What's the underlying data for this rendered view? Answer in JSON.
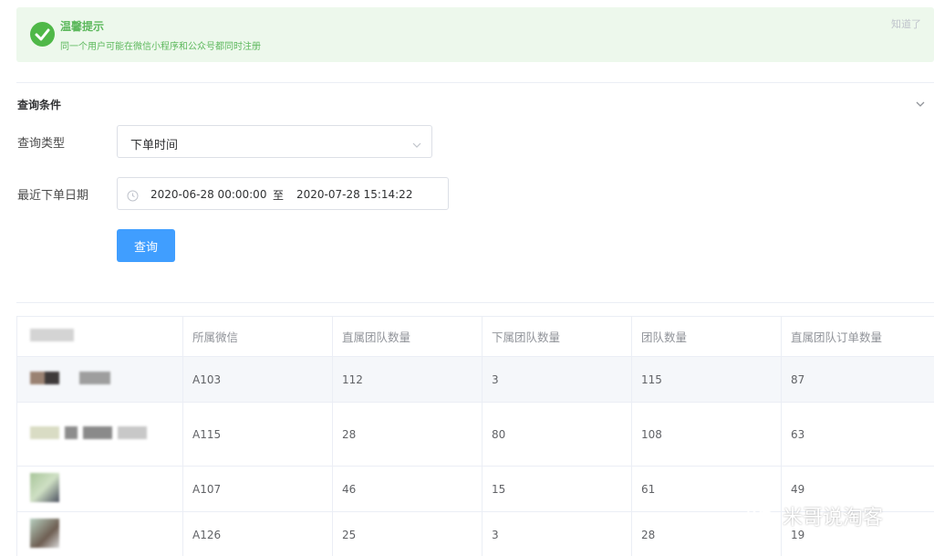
{
  "alert": {
    "title": "温馨提示",
    "description": "同一个用户可能在微信小程序和公众号都同时注册",
    "close_label": "知道了",
    "icon": "check-circle-icon"
  },
  "query_section": {
    "title": "查询条件",
    "collapse_icon": "chevron-down-icon"
  },
  "form": {
    "query_type_label": "查询类型",
    "query_type_value": "下单时间",
    "recent_date_label": "最近下单日期",
    "date_start": "2020-06-28 00:00:00",
    "date_separator": "至",
    "date_end": "2020-07-28 15:14:22",
    "submit_label": "查询"
  },
  "table": {
    "headers": [
      "",
      "所属微信",
      "直属团队数量",
      "下属团队数量",
      "团队数量",
      "直属团队订单数量"
    ],
    "rows": [
      [
        "",
        "A103",
        "112",
        "3",
        "115",
        "87"
      ],
      [
        "",
        "A115",
        "28",
        "80",
        "108",
        "63"
      ],
      [
        "",
        "A107",
        "46",
        "15",
        "61",
        "49"
      ],
      [
        "",
        "A126",
        "25",
        "3",
        "28",
        "19"
      ]
    ]
  },
  "watermark": {
    "text": "米哥说淘客",
    "icon": "wechat-icon"
  },
  "colors": {
    "success": "#5cb85c",
    "success_bg": "#edf8ec",
    "primary": "#409eff",
    "border": "#dcdfe6",
    "row_hover": "#f5f7fa"
  }
}
